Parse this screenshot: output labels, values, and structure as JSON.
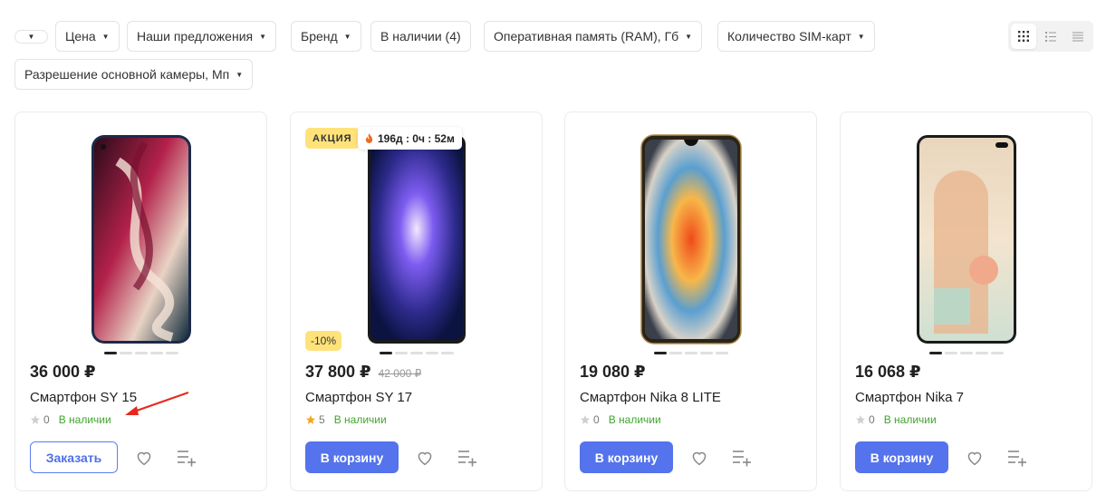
{
  "filters": {
    "empty_chip": "",
    "price": "Цена",
    "offers": "Наши предложения",
    "brand": "Бренд",
    "in_stock": "В наличии (4)",
    "ram": "Оперативная память (RAM), Гб",
    "sim": "Количество SIM-карт",
    "camera": "Разрешение основной камеры, Мп"
  },
  "view_modes": [
    "grid-view-icon",
    "list-view-icon",
    "table-view-icon"
  ],
  "products": [
    {
      "price": "36 000 ₽",
      "old_price": "",
      "name": "Смартфон SY 15",
      "rating": "0",
      "stock": "В наличии",
      "button": "Заказать",
      "star_color": "#cfcfcf"
    },
    {
      "price": "37 800 ₽",
      "old_price": "42 000 ₽",
      "name": "Смартфон SY 17",
      "rating": "5",
      "stock": "В наличии",
      "button": "В корзину",
      "star_color": "#f5a623",
      "badge": "АКЦИЯ",
      "timer": "196д : 0ч : 52м",
      "discount": "-10%"
    },
    {
      "price": "19 080 ₽",
      "old_price": "",
      "name": "Смартфон Nika 8 LITE",
      "rating": "0",
      "stock": "В наличии",
      "button": "В корзину",
      "star_color": "#cfcfcf"
    },
    {
      "price": "16 068 ₽",
      "old_price": "",
      "name": "Смартфон Nika 7",
      "rating": "0",
      "stock": "В наличии",
      "button": "В корзину",
      "star_color": "#cfcfcf"
    }
  ],
  "colors": {
    "accent": "#5473ec",
    "stock_green": "#3fa62b",
    "badge_yellow": "#ffe27a",
    "annotation_red": "#e8271c"
  }
}
